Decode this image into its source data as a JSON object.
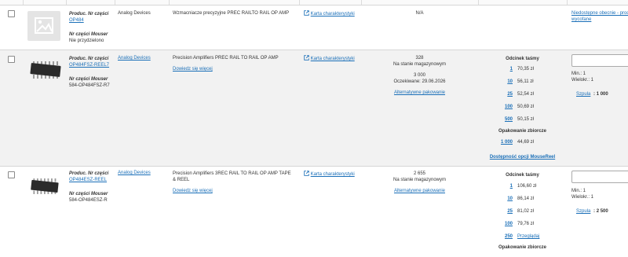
{
  "rows": [
    {
      "mfr_label": "Produc. Nr części",
      "mfr_part": "OP484",
      "mouser_label": "Nr części Mouser",
      "mouser_part": "Nie przydzielono",
      "manufacturer": "Analog Devices",
      "description": "Wzmacniacze precyzyjne PREC RAILTO RAIL OP AMP",
      "datasheet": "Karta charakterystyki",
      "availability": "N/A",
      "status_line1": "Niedostępne obecnie - prod",
      "status_line2": "wycofane"
    },
    {
      "mfr_label": "Produc. Nr części",
      "mfr_part": "OP484FSZ-REEL7",
      "mouser_label": "Nr części Mouser",
      "mouser_part": "584-OP484FSZ-R7",
      "manufacturer": "Analog Devices",
      "description": "Precision Amplifiers PREC RAIL TO RAIL OP AMP",
      "learn_more": "Dowiedz się więcej",
      "datasheet": "Karta charakterystyki",
      "stock_qty": "328",
      "stock_label": "Na stanie magazynowym",
      "incoming_qty": "3 000",
      "incoming_label": "Oczekiwane: 29.06.2026",
      "alt_pack": "Alternatywne pakowanie",
      "price_header": "Odcinek taśmy",
      "prices": [
        {
          "qty": "1",
          "price": "70,35 zł"
        },
        {
          "qty": "10",
          "price": "56,11 zł"
        },
        {
          "qty": "25",
          "price": "52,54 zł"
        },
        {
          "qty": "100",
          "price": "50,69 zł"
        },
        {
          "qty": "500",
          "price": "50,15 zł"
        }
      ],
      "bulk_header": "Opakowanie zbiorcze",
      "bulk_price": {
        "qty": "1 000",
        "price": "44,69 zł"
      },
      "mousereel": "Dostępność opcji MouseReel",
      "min": "Min.: 1",
      "mult": "Wielokr.: 1",
      "reel_label": "Szpula",
      "reel_qty": ": 1 000"
    },
    {
      "mfr_label": "Produc. Nr części",
      "mfr_part": "OP484ESZ-REEL",
      "mouser_label": "Nr części Mouser",
      "mouser_part": "584-OP484ESZ-R",
      "manufacturer": "Analog Devices",
      "description_line1": "Precision Amplifiers 3REC RAIL TO RAIL OP AMP TAPE",
      "description_line2": "& REEL",
      "learn_more": "Dowiedz się więcej",
      "datasheet": "Karta charakterystyki",
      "stock_qty": "2 655",
      "stock_label": "Na stanie magazynowym",
      "alt_pack": "Alternatywne pakowanie",
      "price_header": "Odcinek taśmy",
      "prices": [
        {
          "qty": "1",
          "price": "106,60 zł"
        },
        {
          "qty": "10",
          "price": "86,14 zł"
        },
        {
          "qty": "25",
          "price": "81,02 zł"
        },
        {
          "qty": "100",
          "price": "79,76 zł"
        }
      ],
      "view_qty": "250",
      "view_label": "Przeglądaj",
      "bulk_header": "Opakowanie zbiorcze",
      "min": "Min.: 1",
      "mult": "Wielokr.: 1",
      "reel_label": "Szpula",
      "reel_qty": ": 2 500"
    }
  ],
  "icons": {
    "external": "external-link-icon",
    "placeholder": "image-placeholder-icon",
    "chip": "soic-chip-icon"
  }
}
